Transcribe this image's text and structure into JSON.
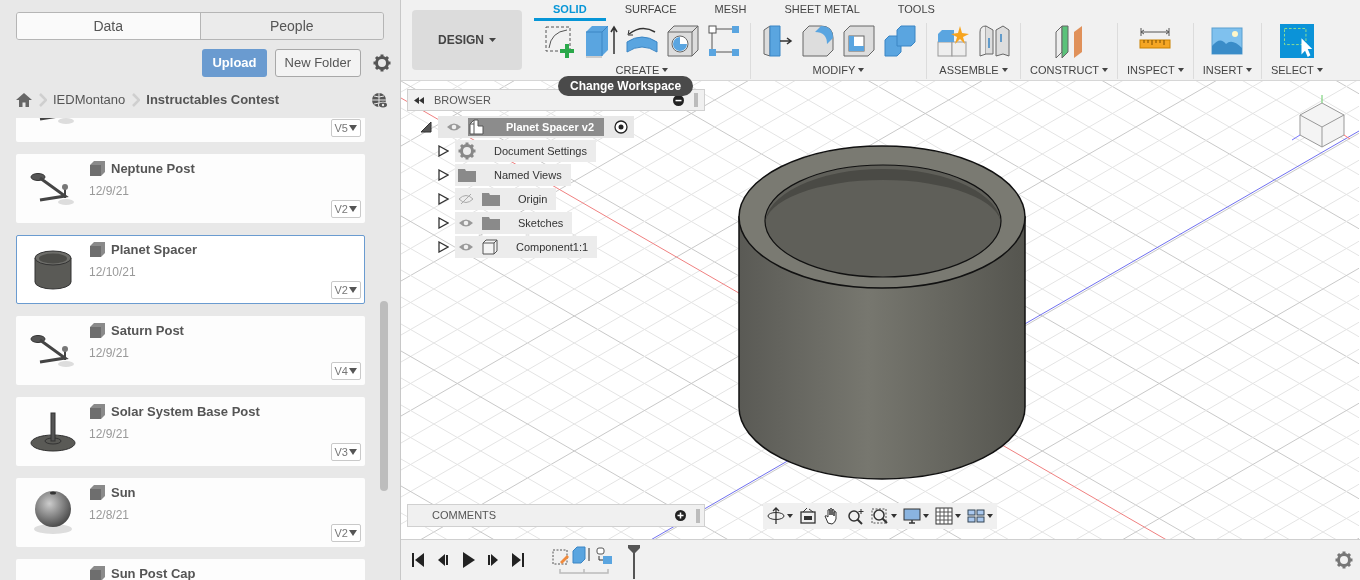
{
  "data_panel": {
    "tabs": [
      {
        "label": "Data",
        "selected": true
      },
      {
        "label": "People",
        "selected": false
      }
    ],
    "upload_button": "Upload",
    "new_folder_button": "New Folder",
    "breadcrumb": [
      "IEDMontano",
      "Instructables Contest"
    ],
    "files": [
      {
        "kind": "post",
        "version": "V5",
        "selected": false
      },
      {
        "kind": "post",
        "name": "Neptune Post",
        "date": "12/9/21",
        "version": "V2",
        "selected": false
      },
      {
        "kind": "spacer",
        "name": "Planet Spacer",
        "date": "12/10/21",
        "version": "V2",
        "selected": true
      },
      {
        "kind": "post",
        "name": "Saturn Post",
        "date": "12/9/21",
        "version": "V4",
        "selected": false
      },
      {
        "kind": "base",
        "name": "Solar System Base Post",
        "date": "12/9/21",
        "version": "V3",
        "selected": false
      },
      {
        "kind": "sphere",
        "name": "Sun",
        "date": "12/8/21",
        "version": "V2",
        "selected": false
      },
      {
        "kind": "cap",
        "name": "Sun Post Cap",
        "selected": false
      }
    ]
  },
  "toolbar": {
    "workspace": "DESIGN",
    "tabs": [
      {
        "label": "SOLID",
        "selected": true
      },
      {
        "label": "SURFACE",
        "selected": false
      },
      {
        "label": "MESH",
        "selected": false
      },
      {
        "label": "SHEET METAL",
        "selected": false
      },
      {
        "label": "TOOLS",
        "selected": false
      }
    ],
    "groups": [
      {
        "label": "CREATE"
      },
      {
        "label": "MODIFY"
      },
      {
        "label": "ASSEMBLE"
      },
      {
        "label": "CONSTRUCT"
      },
      {
        "label": "INSPECT"
      },
      {
        "label": "INSERT"
      },
      {
        "label": "SELECT"
      }
    ]
  },
  "tooltip": "Change Workspace",
  "browser": {
    "title": "BROWSER",
    "root": {
      "label": "Planet Spacer v2",
      "expanded": true,
      "children": [
        {
          "kind": "settings",
          "label": "Document Settings",
          "expanded": false
        },
        {
          "kind": "folder",
          "label": "Named Views",
          "expanded": false
        },
        {
          "kind": "folder",
          "label": "Origin",
          "visible": false,
          "expanded": false
        },
        {
          "kind": "folder",
          "label": "Sketches",
          "visible": true,
          "expanded": false
        },
        {
          "kind": "component",
          "label": "Component1:1",
          "visible": true,
          "expanded": false
        }
      ]
    }
  },
  "comments": {
    "title": "COMMENTS"
  }
}
